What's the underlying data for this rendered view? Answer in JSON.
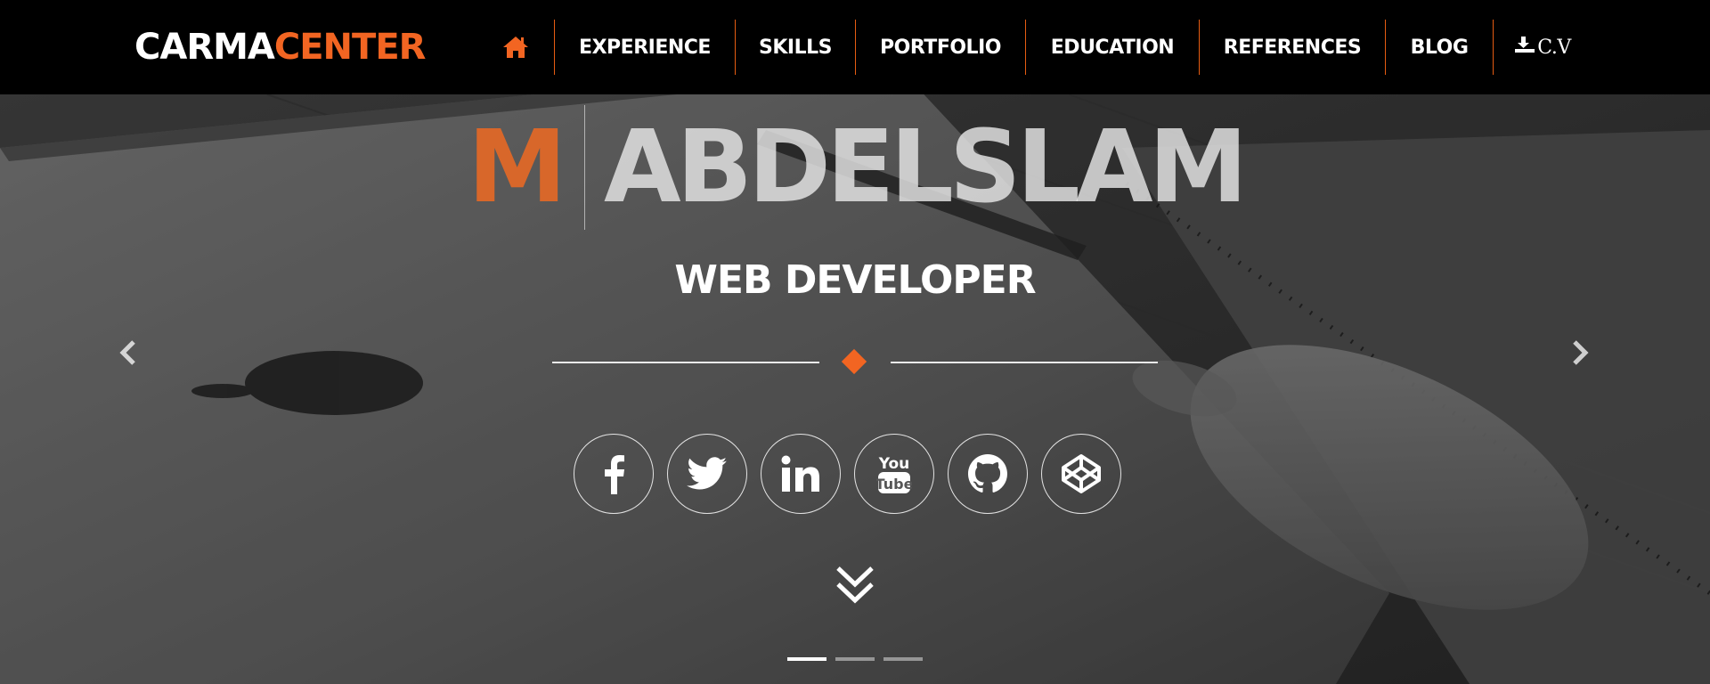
{
  "brand": {
    "part1": "CARMA",
    "part2": "CENTER"
  },
  "nav": {
    "home_icon": "home-icon",
    "items": [
      {
        "label": "EXPERIENCE"
      },
      {
        "label": "SKILLS"
      },
      {
        "label": "PORTFOLIO"
      },
      {
        "label": "EDUCATION"
      },
      {
        "label": "REFERENCES"
      },
      {
        "label": "BLOG"
      }
    ],
    "cv": {
      "icon": "download-icon",
      "label": "C.V"
    }
  },
  "hero": {
    "initial": "M",
    "name": "ABDELSLAM",
    "subtitle": "WEB DEVELOPER",
    "socials": [
      {
        "icon": "facebook-icon"
      },
      {
        "icon": "twitter-icon"
      },
      {
        "icon": "linkedin-icon"
      },
      {
        "icon": "youtube-icon"
      },
      {
        "icon": "github-icon"
      },
      {
        "icon": "codepen-icon"
      }
    ],
    "scroll_icon": "double-chevron-down-icon",
    "carousel": {
      "slides": 3,
      "active": 1
    }
  },
  "colors": {
    "accent": "#f26522",
    "nav_bg": "#000000",
    "text": "#ffffff"
  }
}
